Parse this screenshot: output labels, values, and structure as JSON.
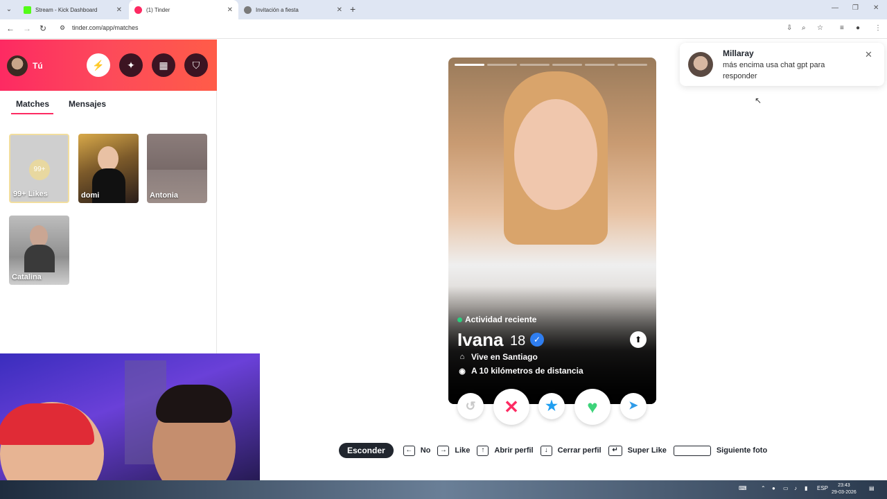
{
  "browser": {
    "tabs": [
      {
        "title": "Stream - Kick Dashboard",
        "favicon_color": "#53fc18"
      },
      {
        "title": "(1) Tinder",
        "favicon_color": "#fd2a62"
      },
      {
        "title": "Invitación a fiesta",
        "favicon_color": "#7a7a7a"
      }
    ],
    "url": "tinder.com/app/matches"
  },
  "sidebar": {
    "user_label": "Tú",
    "tabs": {
      "matches": "Matches",
      "messages": "Mensajes"
    },
    "likes_badge": "99+",
    "likes_label": "99+ Likes",
    "matches": [
      {
        "name": "domi"
      },
      {
        "name": "Antonia"
      },
      {
        "name": "Catalina"
      }
    ]
  },
  "profile": {
    "activity": "Actividad reciente",
    "name": "Ivana",
    "age": "18",
    "lives_in": "Vive en Santiago",
    "distance": "A 10 kilómetros de distancia",
    "photo_index": 1,
    "photo_count": 6
  },
  "shortcuts": {
    "hide_button": "Esconder",
    "no": "No",
    "like": "Like",
    "open_profile": "Abrir perfil",
    "close_profile": "Cerrar perfil",
    "super_like": "Super Like",
    "next_photo": "Siguiente foto"
  },
  "notification": {
    "name": "Millaray",
    "message": "más encima usa chat gpt para responder"
  },
  "taskbar": {
    "lang": "ESP",
    "time": "23:43",
    "date": "29-03-2026"
  },
  "colors": {
    "brand": "#fd2a62",
    "nope": "#fd2a62",
    "superlike": "#1f9ef0",
    "like": "#3dd37a",
    "boost": "#2f9be8"
  }
}
